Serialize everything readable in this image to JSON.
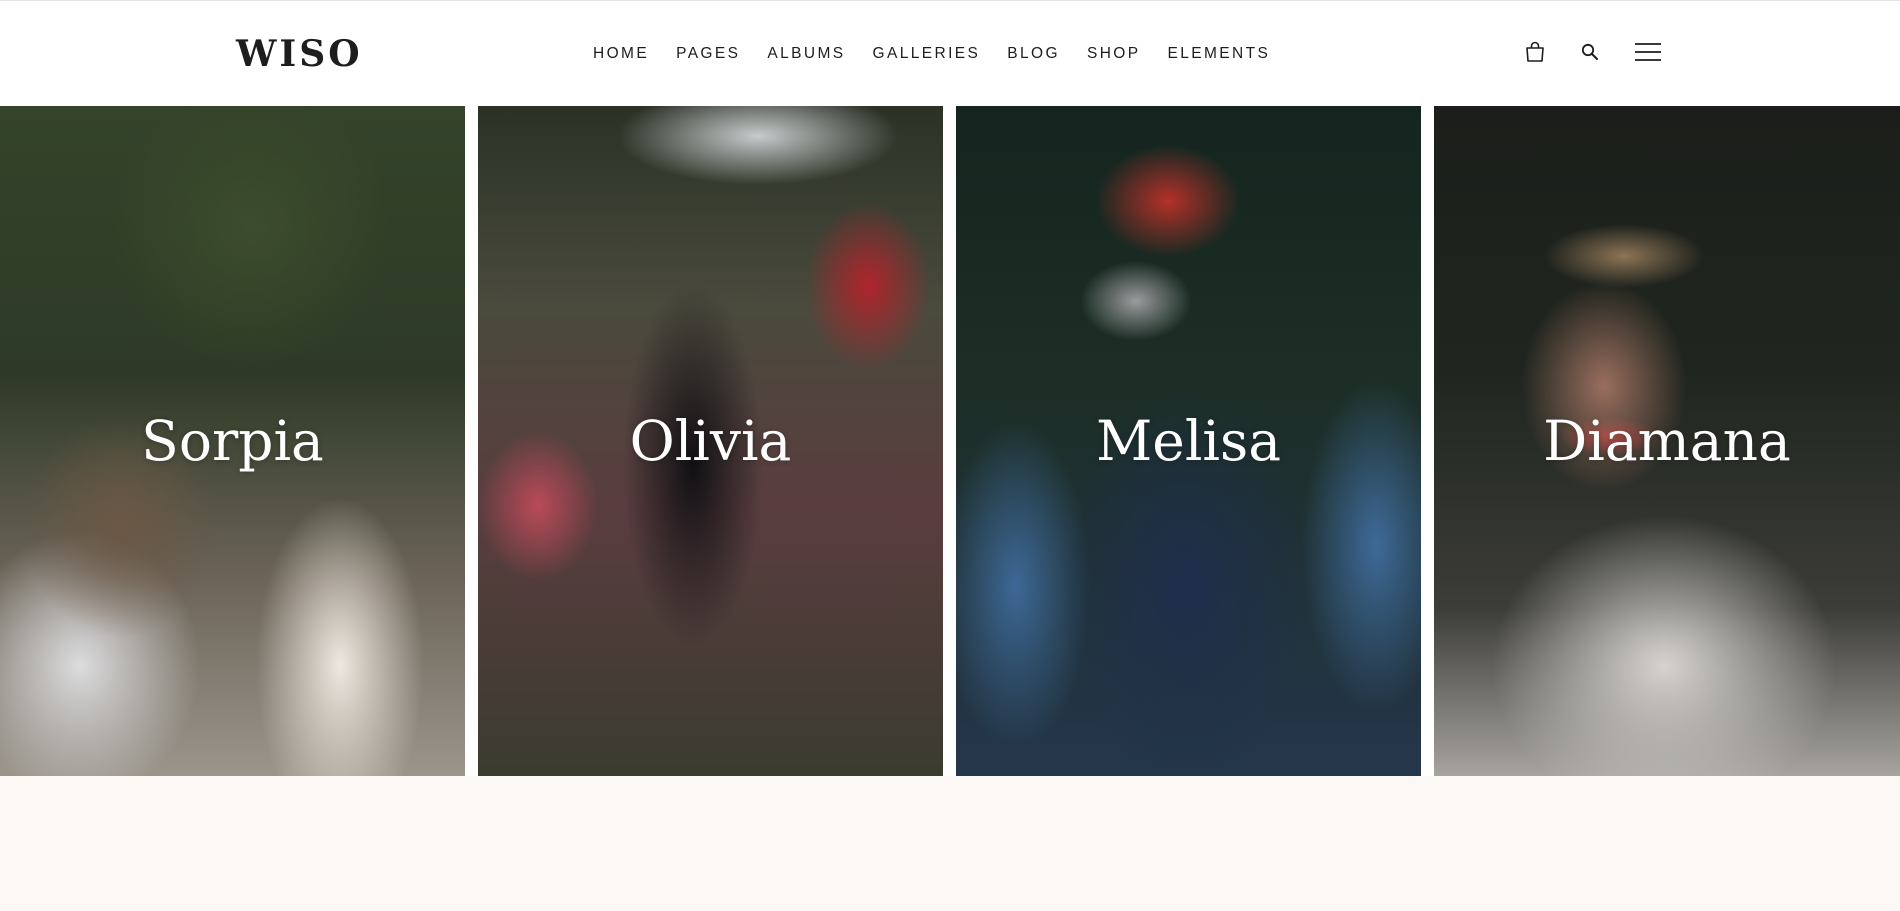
{
  "brand": {
    "logo_text": "WISO"
  },
  "nav": {
    "items": [
      "HOME",
      "PAGES",
      "ALBUMS",
      "GALLERIES",
      "BLOG",
      "SHOP",
      "ELEMENTS"
    ]
  },
  "header_icons": {
    "cart": "shopping-bag-icon",
    "search": "search-icon",
    "menu": "hamburger-menu-icon"
  },
  "albums": [
    {
      "name": "Sorpia"
    },
    {
      "name": "Olivia"
    },
    {
      "name": "Melisa"
    },
    {
      "name": "Diamana"
    }
  ],
  "colors": {
    "background": "#fcf8f5",
    "header_bg": "#ffffff",
    "text_dark": "#1d1d1d",
    "overlay_text": "#ffffff"
  }
}
